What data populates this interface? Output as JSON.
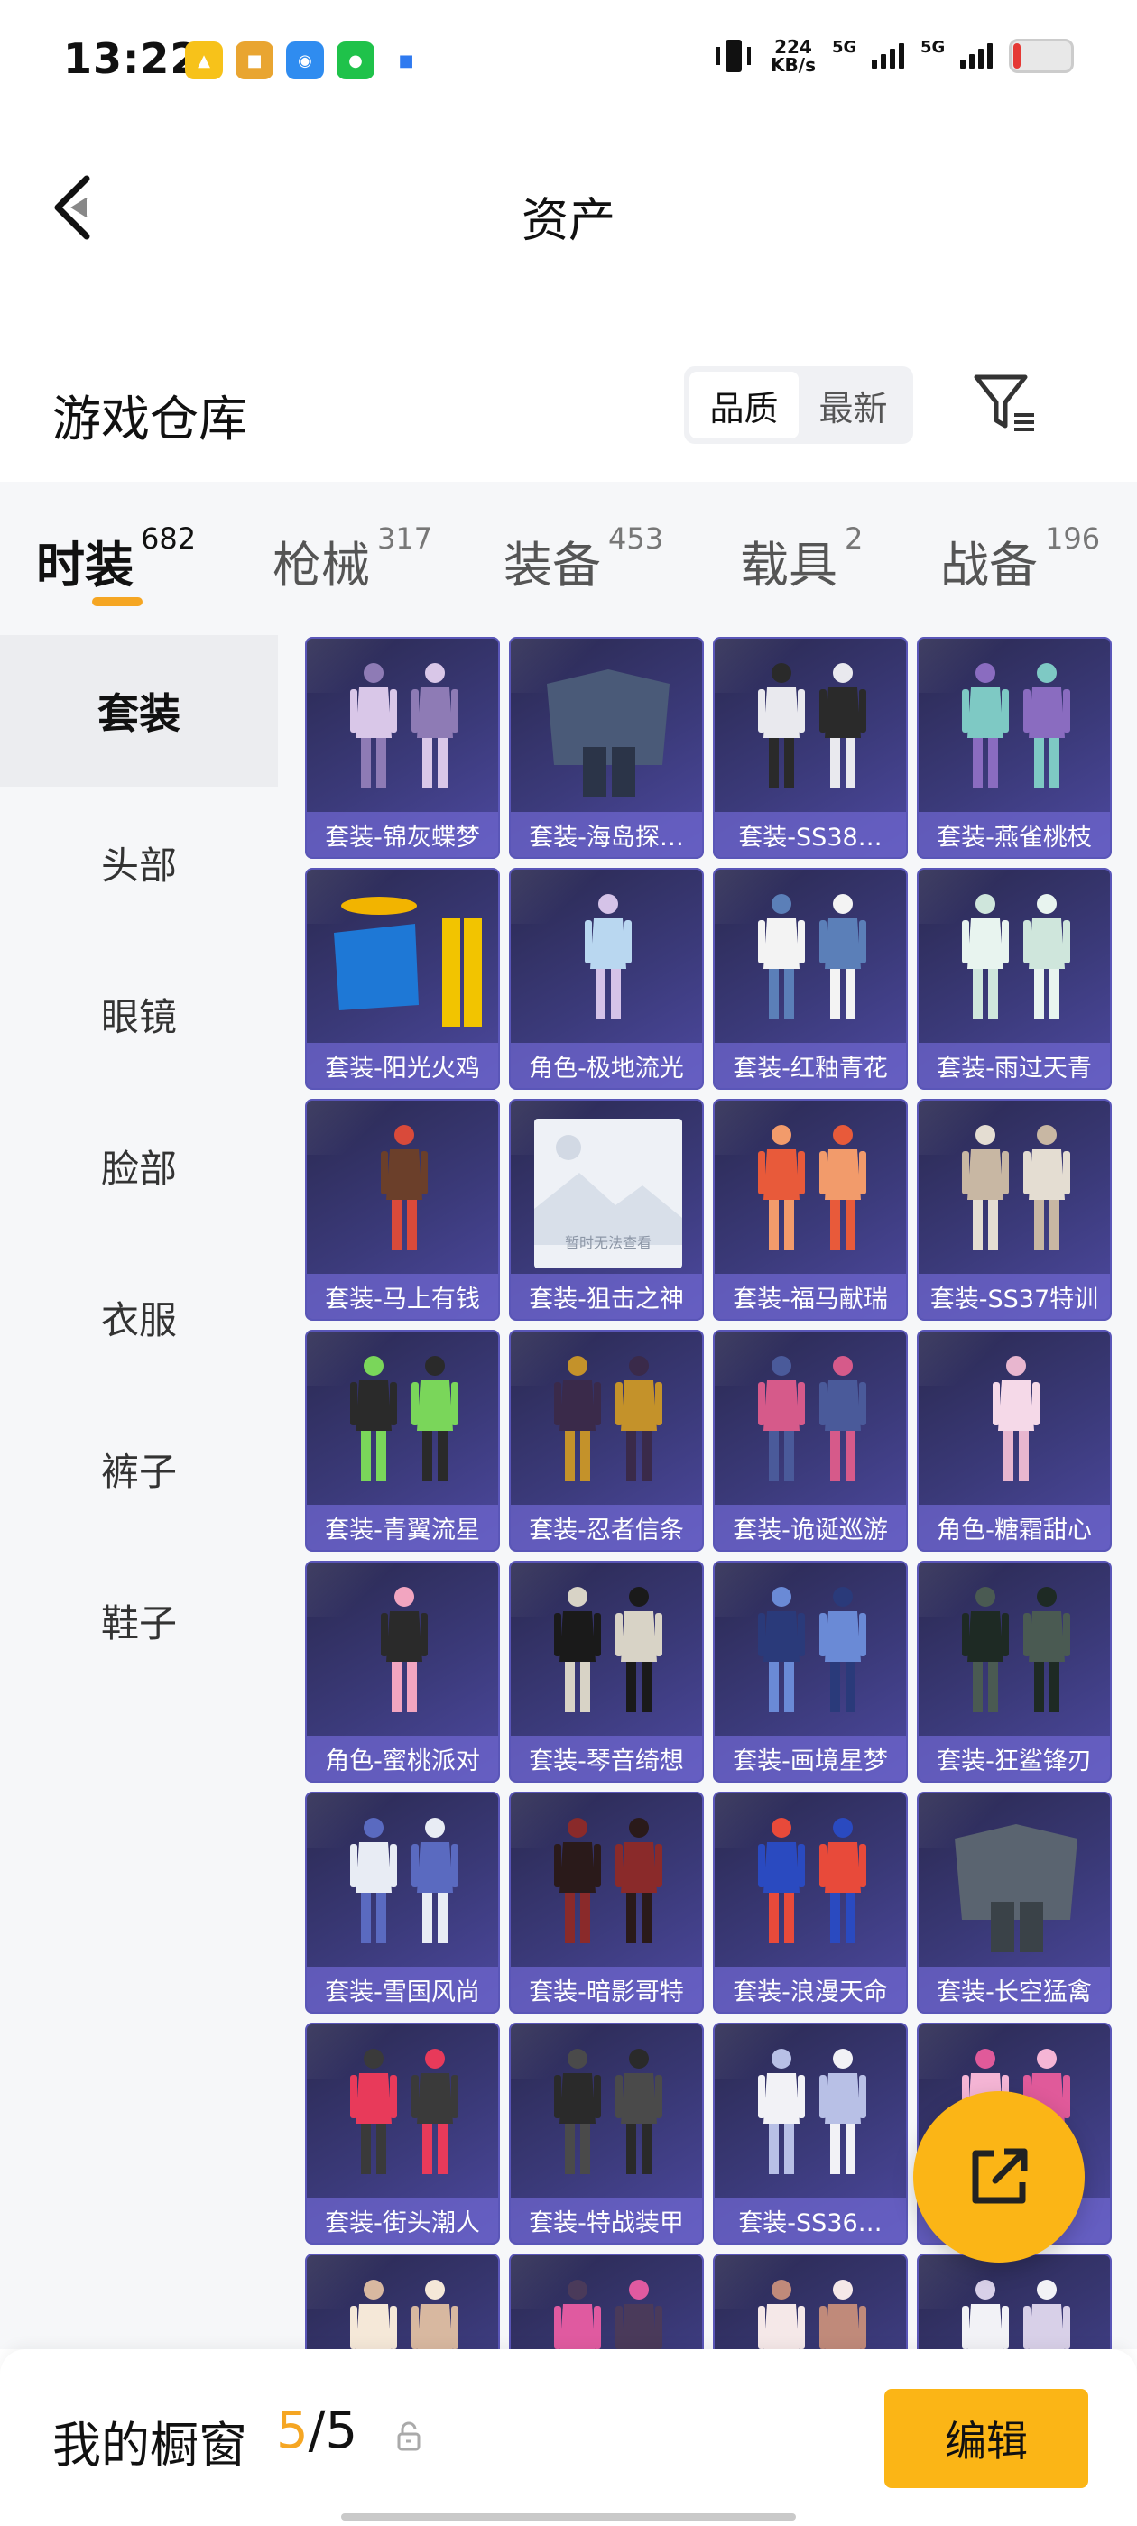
{
  "status_bar": {
    "time": "13:22",
    "net_speed_value": "224",
    "net_speed_unit": "KB/s",
    "sim1": "5G",
    "sim2": "5G",
    "notification_icons": [
      "game-app-icon",
      "pubg-news-icon",
      "browser-icon",
      "wechat-icon",
      "message-icon"
    ]
  },
  "header": {
    "title": "资产",
    "back_icon": "chevron-left-icon"
  },
  "warehouse": {
    "title": "游戏仓库",
    "sort_options": [
      "品质",
      "最新"
    ],
    "sort_selected": "品质",
    "filter_icon": "filter-list-icon"
  },
  "tabs": [
    {
      "label": "时装",
      "count": "682",
      "active": true
    },
    {
      "label": "枪械",
      "count": "317",
      "active": false
    },
    {
      "label": "装备",
      "count": "453",
      "active": false
    },
    {
      "label": "载具",
      "count": "2",
      "active": false
    },
    {
      "label": "战备",
      "count": "196",
      "active": false
    }
  ],
  "categories": [
    {
      "label": "套装",
      "active": true
    },
    {
      "label": "头部",
      "active": false
    },
    {
      "label": "眼镜",
      "active": false
    },
    {
      "label": "脸部",
      "active": false
    },
    {
      "label": "衣服",
      "active": false
    },
    {
      "label": "裤子",
      "active": false
    },
    {
      "label": "鞋子",
      "active": false
    }
  ],
  "items": [
    "套装-锦灰蝶梦",
    "套装-海岛探…",
    "套装-SS38…",
    "套装-燕雀桃枝",
    "套装-阳光火鸡",
    "角色-极地流光",
    "套装-红釉青花",
    "套装-雨过天青",
    "套装-马上有钱",
    "套装-狙击之神",
    "套装-福马献瑞",
    "套装-SS37特训",
    "套装-青翼流星",
    "套装-忍者信条",
    "套装-诡诞巡游",
    "角色-糖霜甜心",
    "角色-蜜桃派对",
    "套装-琴音绮想",
    "套装-画境星梦",
    "套装-狂鲨锋刃",
    "套装-雪国风尚",
    "套装-暗影哥特",
    "套装-浪漫天命",
    "套装-长空猛禽",
    "套装-街头潮人",
    "套装-特战装甲",
    "套装-SS36…",
    "果",
    "",
    "",
    "",
    ""
  ],
  "image_placeholder_text": "暂时无法查看",
  "showcase": {
    "title": "我的橱窗",
    "current": "5",
    "separator": "/",
    "total": "5",
    "edit_label": "编辑",
    "lock_icon": "lock-icon"
  },
  "fab_icon": "share-external-icon",
  "colors": {
    "accent": "#fbb516",
    "tab_indicator": "#f5a623",
    "card_bg": "#3b3a7a",
    "card_border": "#5a56b8",
    "caption_bg": "#6e66ce"
  }
}
